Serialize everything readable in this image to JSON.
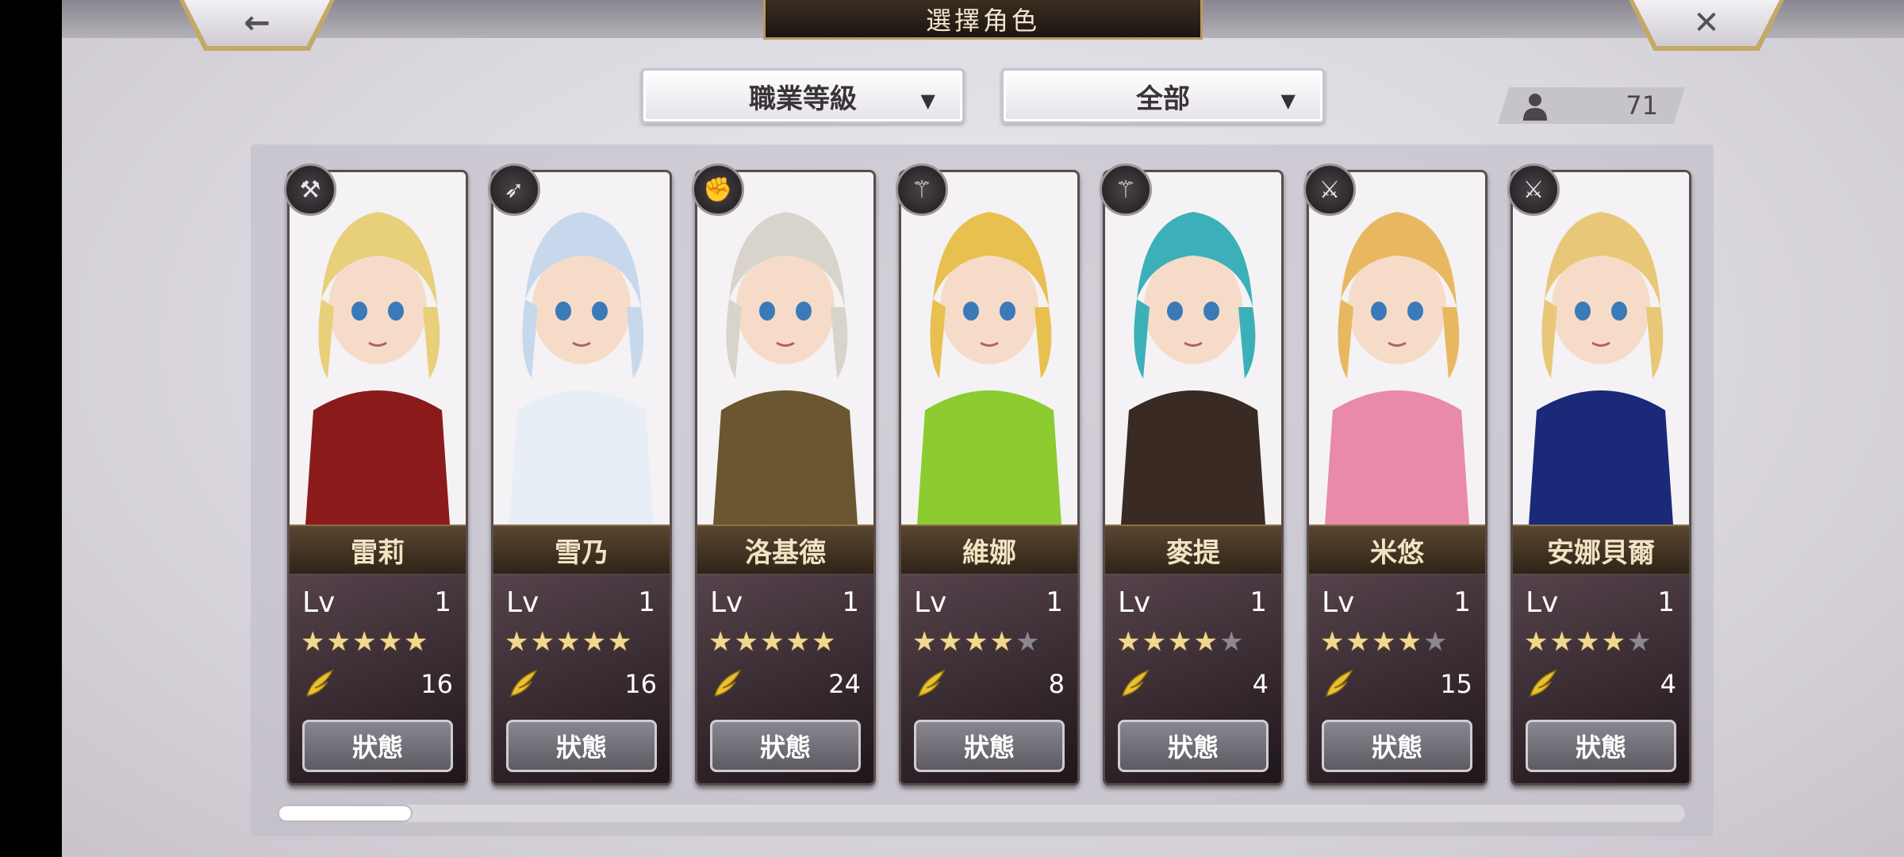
{
  "header": {
    "title": "選擇角色",
    "back_icon": "←",
    "close_icon": "✕"
  },
  "filters": {
    "job": {
      "label": "職業等級",
      "arrow": "▼"
    },
    "type": {
      "label": "全部",
      "arrow": "▼"
    }
  },
  "character_count": "71",
  "level_label": "Lv",
  "status_label": "狀態",
  "characters": [
    {
      "name": "雷莉",
      "level": "1",
      "stars": 5,
      "count": "16",
      "class_icon": "axe-icon",
      "hair": "#e8cf7a",
      "cloth": "#8b1a1a"
    },
    {
      "name": "雪乃",
      "level": "1",
      "stars": 5,
      "count": "16",
      "class_icon": "bow-icon",
      "hair": "#c8d8ec",
      "cloth": "#e8eef6"
    },
    {
      "name": "洛基德",
      "level": "1",
      "stars": 5,
      "count": "24",
      "class_icon": "fist-icon",
      "hair": "#d8d4cc",
      "cloth": "#6a5630"
    },
    {
      "name": "維娜",
      "level": "1",
      "stars": 4,
      "count": "8",
      "class_icon": "staff-icon",
      "hair": "#e8c050",
      "cloth": "#8ccc30"
    },
    {
      "name": "麥提",
      "level": "1",
      "stars": 4,
      "count": "4",
      "class_icon": "staff-icon",
      "hair": "#3cb0b8",
      "cloth": "#3a2a24"
    },
    {
      "name": "米悠",
      "level": "1",
      "stars": 4,
      "count": "15",
      "class_icon": "sword-icon",
      "hair": "#e8b860",
      "cloth": "#e88aa8"
    },
    {
      "name": "安娜貝爾",
      "level": "1",
      "stars": 4,
      "count": "4",
      "class_icon": "sword-icon",
      "hair": "#e8c878",
      "cloth": "#1a2a78"
    }
  ]
}
